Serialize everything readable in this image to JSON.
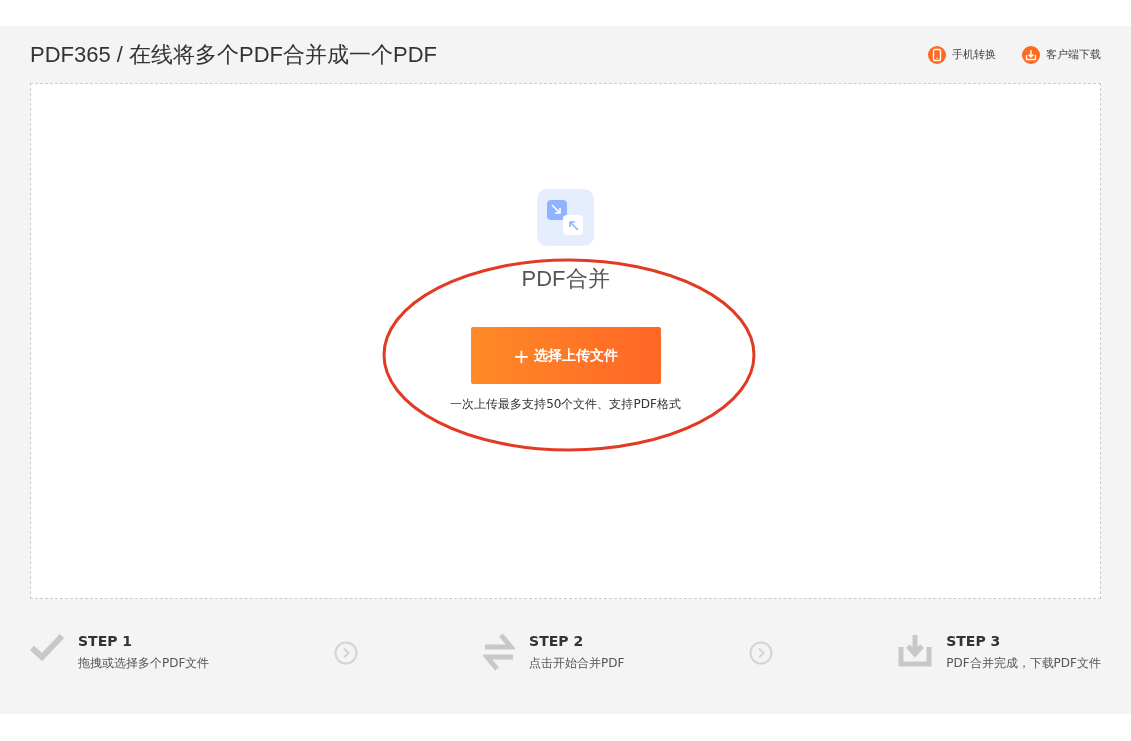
{
  "header": {
    "title": "PDF365 / 在线将多个PDF合并成一个PDF",
    "links": [
      {
        "kind": "phone",
        "label": "手机转换"
      },
      {
        "kind": "download",
        "label": "客户端下载"
      }
    ]
  },
  "upload": {
    "title": "PDF合并",
    "button": {
      "icon": "+",
      "label": "选择上传文件"
    },
    "hint": "一次上传最多支持50个文件、支持PDF格式"
  },
  "steps": [
    {
      "kind": "check",
      "title": "STEP 1",
      "text": "拖拽或选择多个PDF文件"
    },
    {
      "kind": "swap",
      "title": "STEP 2",
      "text": "点击开始合并PDF"
    },
    {
      "kind": "download",
      "title": "STEP 3",
      "text": "PDF合并完成，下载PDF文件"
    }
  ]
}
